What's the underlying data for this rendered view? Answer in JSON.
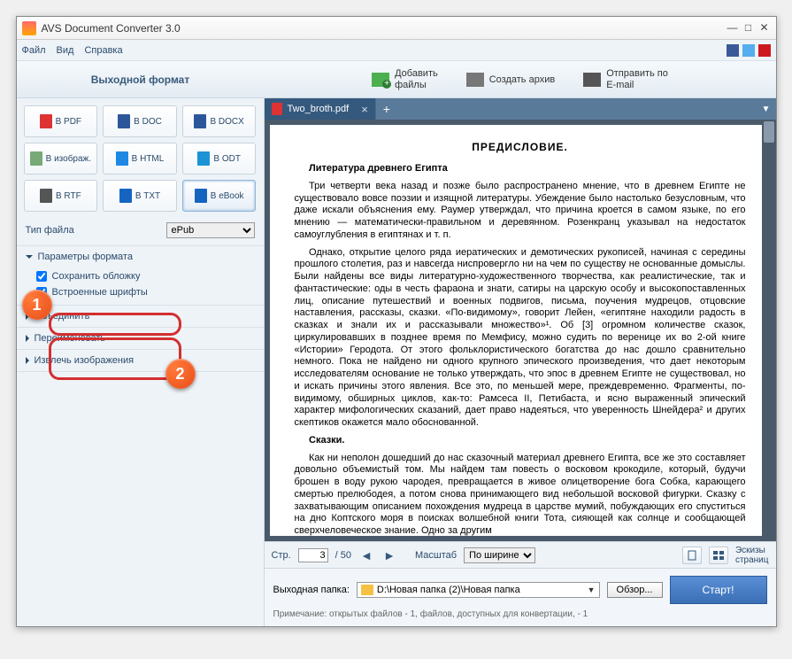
{
  "title": "AVS Document Converter 3.0",
  "menubar": [
    "Файл",
    "Вид",
    "Справка"
  ],
  "toolbar": {
    "heading": "Выходной формат",
    "add": "Добавить\nфайлы",
    "archive": "Создать архив",
    "email": "Отправить по\nE-mail"
  },
  "formats": [
    {
      "label": "В PDF"
    },
    {
      "label": "В DOC"
    },
    {
      "label": "В DOCX"
    },
    {
      "label": "В изображ."
    },
    {
      "label": "В HTML"
    },
    {
      "label": "В ODT"
    },
    {
      "label": "В RTF"
    },
    {
      "label": "В TXT"
    },
    {
      "label": "В eBook",
      "active": true
    }
  ],
  "filetype": {
    "label": "Тип файла",
    "value": "ePub"
  },
  "accordion": {
    "params": {
      "title": "Параметры формата",
      "open": true,
      "checks": [
        {
          "label": "Сохранить обложку",
          "checked": true
        },
        {
          "label": "Встроенные шрифты",
          "checked": true
        }
      ]
    },
    "merge": "Объединить",
    "rename": "Переименовать",
    "extract": "Извлечь изображения"
  },
  "tab": {
    "name": "Two_broth.pdf"
  },
  "preview": {
    "heading": "ПРЕДИСЛОВИЕ.",
    "sub1": "Литература древнего Египта",
    "p1": "Три четверти века назад и позже было распространено мнение, что в древнем Египте не существовало вовсе поэзии и изящной литературы. Убеждение было настолько безусловным, что даже искали объяснения ему. Раумер утверждал, что причина кроется в самом языке, по его мнению — математически-правильном и деревянном. Розенкранц указывал на недостаток самоуглубления в египтянах и т. п.",
    "p2": "Однако, открытие целого ряда иератических и демотических рукописей, начиная с середины прошлого столетия, раз и навсегда ниспровергло ни на чем по существу не основанные домыслы. Были найдены все виды литературно-художественного творчества, как реалистические, так и фантастические: оды в честь фараона и знати, сатиры на царскую особу и высокопоставленных лиц, описание путешествий и военных подвигов, письма, поучения мудрецов, отцовские наставления, рассказы, сказки. «По-видимому», говорит Лейен, «египтяне находили радость в сказках и знали их и рассказывали множество»¹. Об [3] огромном количестве сказок, циркулировавших в позднее время по Мемфису, можно судить по вереницe их во 2-ой книге «Истории» Геродота. От этого фольклористического богатства до нас дошло сравнительно немного. Пока не найдено ни одного крупного эпического произведения, что дает некоторым исследователям основание не только утверждать, что эпос в древнем Египте не существовал, но и искать причины этого явления. Все это, по меньшей мере, преждевременно. Фрагменты, по-видимому, обширных циклов, как-то: Рамсеса II, Петибаста, и ясно выраженный эпический характер мифологических сказаний, дает право надеяться, что уверенность Шнейдера² и других скептиков окажется мало обоснованной.",
    "sub2": "Сказки.",
    "p3": "Как ни неполон дошедший до нас сказочный материал древнего Египта, все же это составляет довольно объемистый том. Мы найдем там повесть о восковом крокодиле, который, будучи брошен в воду рукою чародея, превращается в живое олицетворение бога Собка, карающего смертью прелюбодея, а потом снова принимающего вид небольшой восковой фигурки. Сказку с захватывающим описанием похождения мудреца в царстве мумий, побуждающих его спуститься на дно Коптского моря в поисках волшебной книги Тота, сияющей как солнце и сообщающей сверхчеловеческое знание. Одно за другим"
  },
  "pager": {
    "pageLabel": "Стр.",
    "current": "3",
    "total": "/ 50",
    "zoomLabel": "Масштаб",
    "zoomValue": "По ширине",
    "thumbs": "Эскизы\nстраниц"
  },
  "output": {
    "label": "Выходная папка:",
    "path": "D:\\Новая папка (2)\\Новая папка",
    "browse": "Обзор...",
    "start": "Старт!"
  },
  "note": "Примечание: открытых файлов - 1, файлов, доступных для конвертации, - 1"
}
